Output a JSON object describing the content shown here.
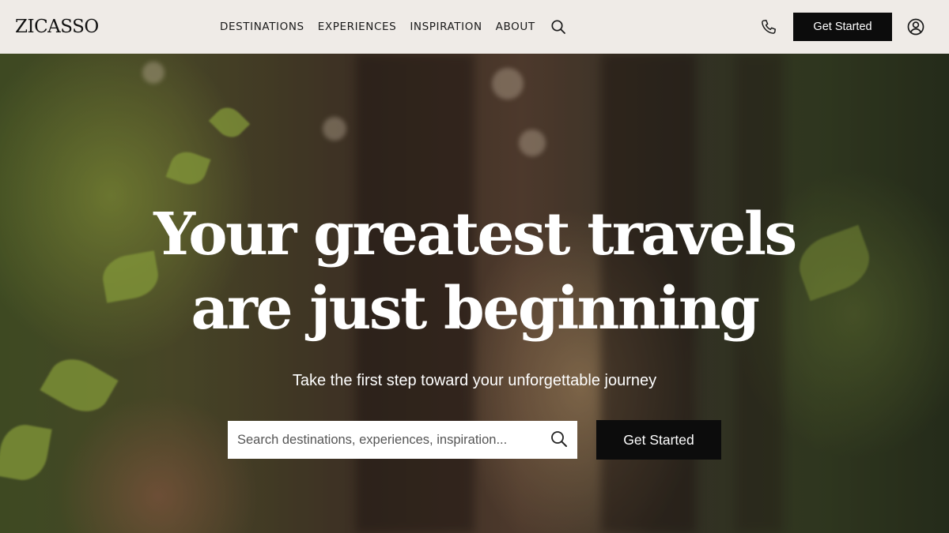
{
  "header": {
    "logo": "ZICASSO",
    "nav": [
      "DESTINATIONS",
      "EXPERIENCES",
      "INSPIRATION",
      "ABOUT"
    ],
    "search_icon": "search-icon",
    "phone_icon": "phone-icon",
    "cta_label": "Get Started",
    "account_icon": "user-circle-icon",
    "background": "#efebe7"
  },
  "hero": {
    "headline_line1": "Your greatest travels",
    "headline_line2": "are just beginning",
    "subhead": "Take the first step toward your unforgettable journey",
    "search_placeholder": "Search destinations, experiences, inspiration...",
    "search_icon": "search-icon",
    "cta_label": "Get Started"
  },
  "colors": {
    "button_bg": "#0c0c0c",
    "button_text": "#ffffff",
    "header_bg": "#efebe7",
    "text_dark": "#1a1a1a"
  }
}
